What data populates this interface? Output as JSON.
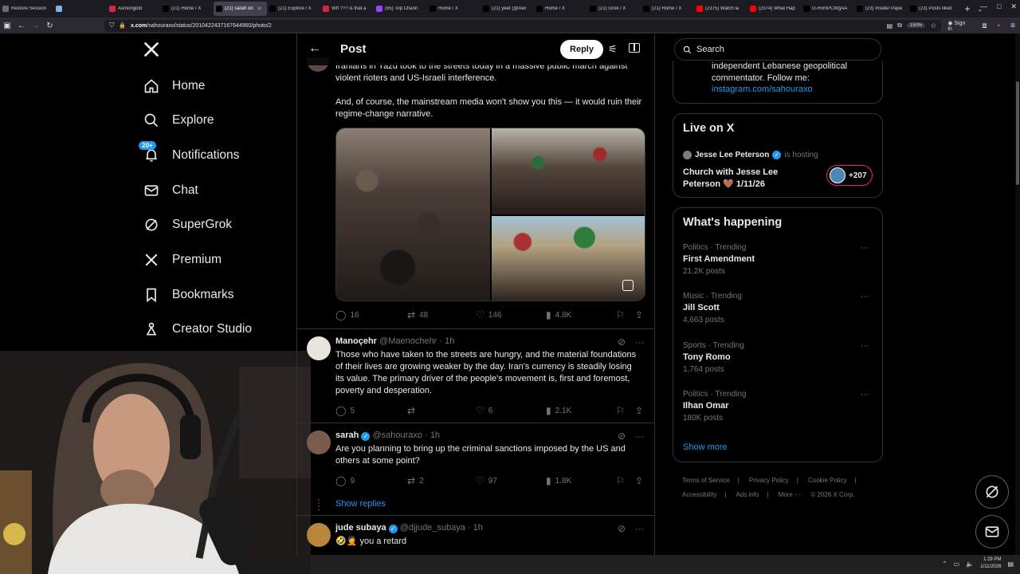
{
  "browser": {
    "tabs": [
      {
        "label": "Restore Session",
        "color": "#6b6b78"
      },
      {
        "label": "",
        "color": "#7fb2e6"
      },
      {
        "label": "Asmongold",
        "color": "#d7263d"
      },
      {
        "label": "(21) Home / X",
        "color": "#000000"
      },
      {
        "label": "(21) sarah on",
        "color": "#000000",
        "active": true
      },
      {
        "label": "(21) Explore / X",
        "color": "#000000"
      },
      {
        "label": "Wtf ??? is that a",
        "color": "#d7263d"
      },
      {
        "label": "(85) Top Chann",
        "color": "#9146ff"
      },
      {
        "label": "Home / X",
        "color": "#000000"
      },
      {
        "label": "(21) yeet (@Awi",
        "color": "#000000"
      },
      {
        "label": "Home / X",
        "color": "#000000"
      },
      {
        "label": "(21) Grok / X",
        "color": "#000000"
      },
      {
        "label": "(21) Home / X",
        "color": "#000000"
      },
      {
        "label": "(2375) Watch la",
        "color": "#ff0000"
      },
      {
        "label": "(2374) What Hap",
        "color": "#ff0000"
      },
      {
        "label": "G-RvmPCWgAA",
        "color": "#000000"
      },
      {
        "label": "(23) Insider Pape",
        "color": "#000000"
      },
      {
        "label": "(23) Posts liked",
        "color": "#000000"
      }
    ],
    "url_host": "x.com",
    "url_path": "/sahouraxo/status/2010422437167644960/photo/2",
    "zoom": "150%",
    "sign_in": "Sign in"
  },
  "sidebar": {
    "logo": "X",
    "items": [
      {
        "label": "Home",
        "icon": "home-icon"
      },
      {
        "label": "Explore",
        "icon": "search-icon"
      },
      {
        "label": "Notifications",
        "icon": "bell-icon",
        "badge": "20+"
      },
      {
        "label": "Chat",
        "icon": "mail-icon"
      },
      {
        "label": "SuperGrok",
        "icon": "grok-icon"
      },
      {
        "label": "Premium",
        "icon": "x-icon"
      },
      {
        "label": "Bookmarks",
        "icon": "bookmark-icon"
      },
      {
        "label": "Creator Studio",
        "icon": "creator-icon"
      }
    ]
  },
  "main": {
    "header_title": "Post",
    "reply_button": "Reply",
    "post_text_1": "Iranians in Yazd took to the streets today in a massive public march against violent rioters and US-Israeli interference.",
    "post_text_2": "And, of course, the mainstream media won't show you this — it would ruin their regime-change narrative.",
    "post_stats": {
      "replies": "16",
      "reposts": "48",
      "likes": "146",
      "views": "4.8K"
    },
    "replies": [
      {
        "name": "Manoçehr",
        "handle": "@Maenochehr",
        "time": "· 1h",
        "verified": false,
        "text": "Those who have taken to the streets are hungry, and the material foundations of their lives are growing weaker by the day. Iran's currency is steadily losing its value. The primary driver of the people's movement is, first and foremost, poverty and desperation.",
        "stats": {
          "replies": "5",
          "reposts": "",
          "likes": "6",
          "views": "2.1K"
        }
      },
      {
        "name": "sarah",
        "handle": "@sahouraxo",
        "time": "· 1h",
        "verified": true,
        "text": "Are you planning to bring up the criminal sanctions imposed by the US and others at some point?",
        "stats": {
          "replies": "9",
          "reposts": "2",
          "likes": "97",
          "views": "1.8K"
        }
      },
      {
        "name": "jude subaya",
        "handle": "@djjude_subaya",
        "time": "· 1h",
        "verified": true,
        "text": "🤣🤦 you a retard",
        "stats": {
          "replies": "",
          "reposts": "",
          "likes": "",
          "views": ""
        }
      }
    ],
    "show_replies": "Show replies"
  },
  "right": {
    "search_placeholder": "Search",
    "bio_text": "independent Lebanese geopolitical commentator. Follow me:",
    "bio_link": "instagram.com/sahouraxo",
    "live": {
      "title": "Live on X",
      "host_name": "Jesse Lee Peterson",
      "host_suffix": "is hosting",
      "space_title": "Church with Jesse Lee Peterson 🤎 1/11/26",
      "listeners": "+207"
    },
    "trending_title": "What's happening",
    "trends": [
      {
        "meta": "Politics · Trending",
        "name": "First Amendment",
        "count": "21.2K posts"
      },
      {
        "meta": "Music · Trending",
        "name": "Jill Scott",
        "count": "4,663 posts"
      },
      {
        "meta": "Sports · Trending",
        "name": "Tony Romo",
        "count": "1,764 posts"
      },
      {
        "meta": "Politics · Trending",
        "name": "Ilhan Omar",
        "count": "180K posts"
      }
    ],
    "show_more": "Show more",
    "footer": [
      "Terms of Service",
      "Privacy Policy",
      "Cookie Policy",
      "Accessibility",
      "Ads info",
      "More ···",
      "© 2026 X Corp."
    ]
  },
  "taskbar": {
    "time": "1:29 PM",
    "date": "1/11/2026"
  },
  "colors": {
    "accent": "#1d9bf0",
    "background": "#000000",
    "border": "#2f3336",
    "muted": "#71767b",
    "live": "#f91880"
  }
}
